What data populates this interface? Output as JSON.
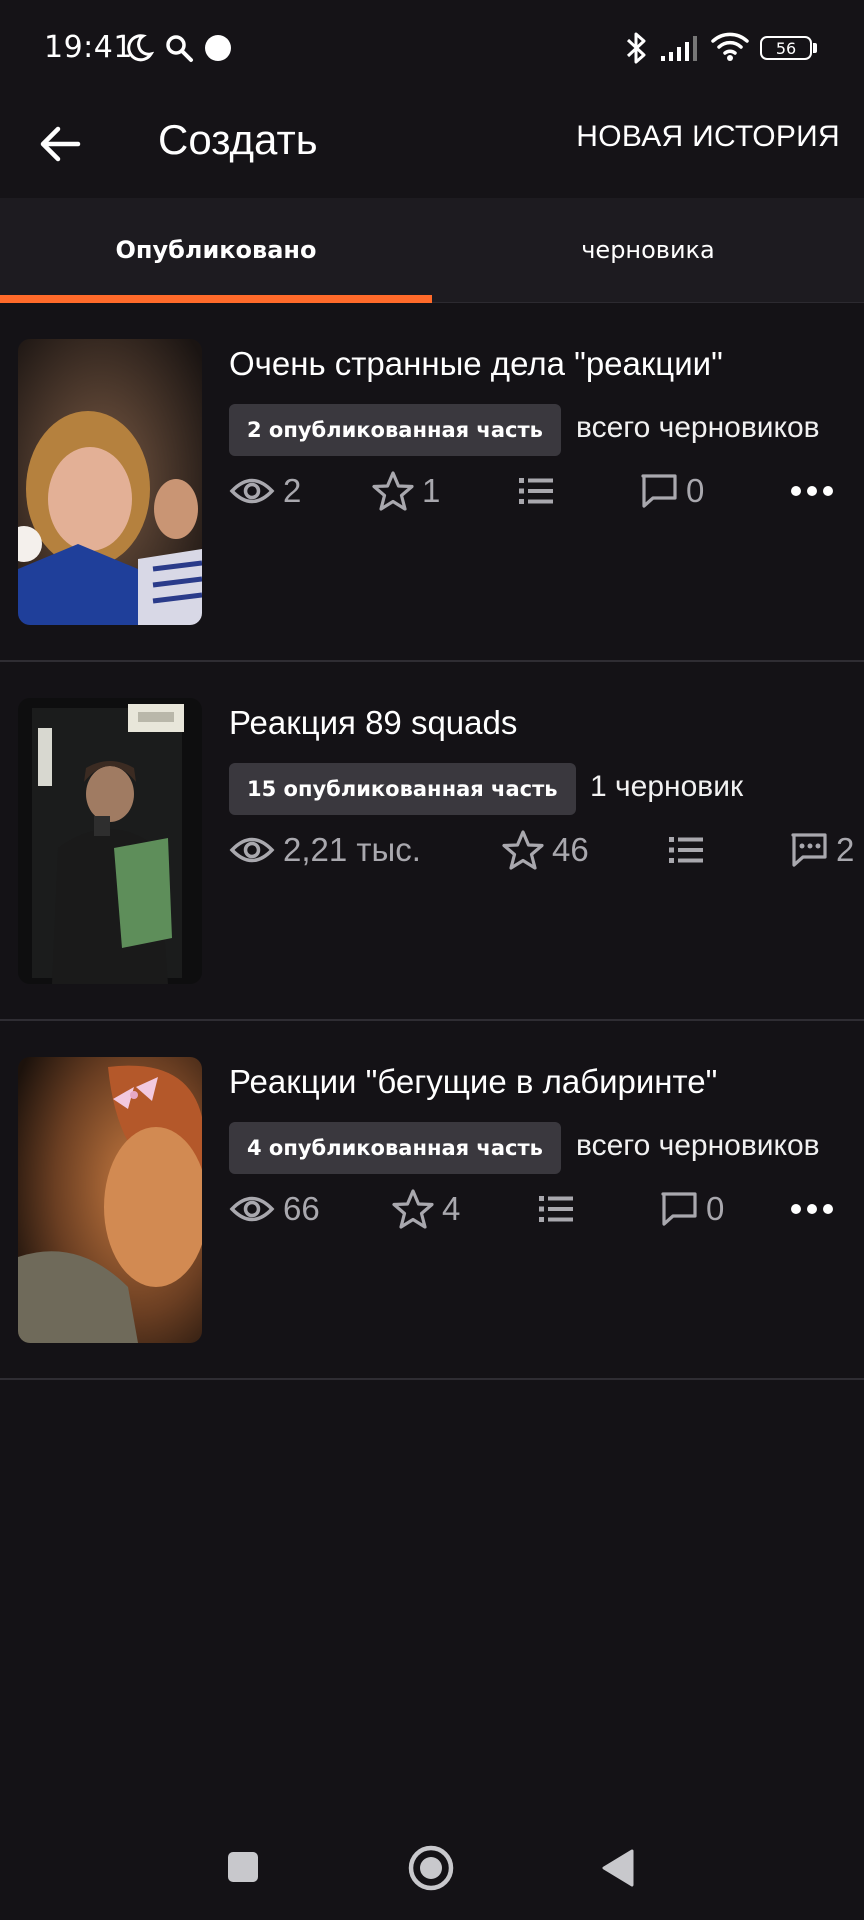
{
  "status_bar": {
    "time": "19:41",
    "battery": "56",
    "icons": [
      "moon-icon",
      "search-icon",
      "dot-icon",
      "bluetooth-icon",
      "signal-icon",
      "wifi-icon",
      "battery-icon"
    ]
  },
  "app_bar": {
    "title": "Создать",
    "new_story": "НОВАЯ ИСТОРИЯ"
  },
  "tabs": [
    {
      "label": "Опубликовано",
      "active": true
    },
    {
      "label": "черновика",
      "active": false
    }
  ],
  "stories": [
    {
      "title": "Очень странные дела \"реакции\"",
      "badge": "2 опубликованная часть",
      "drafts": "всего черновиков",
      "views": "2",
      "votes": "1",
      "comments": "0"
    },
    {
      "title": "Реакция 89 squads",
      "badge": "15 опубликованная часть",
      "drafts": "1 черновик",
      "views": "2,21 тыс.",
      "votes": "46",
      "comments": "2"
    },
    {
      "title": "Реакции \"бегущие в лабиринте\"",
      "badge": "4 опубликованная часть",
      "drafts": "всего черновиков",
      "views": "66",
      "votes": "4",
      "comments": "0"
    }
  ],
  "colors": {
    "background": "#141216",
    "accent": "#ff6a2a",
    "badge_bg": "#3a383e",
    "stat_text": "#a9a8ae"
  }
}
